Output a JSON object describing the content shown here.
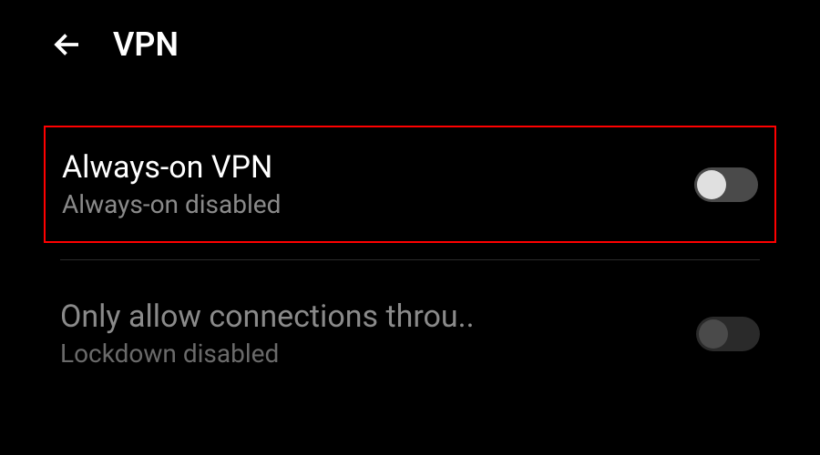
{
  "header": {
    "title": "VPN"
  },
  "settings": {
    "always_on": {
      "title": "Always-on VPN",
      "subtitle": "Always-on disabled"
    },
    "lockdown": {
      "title": "Only allow connections throu",
      "subtitle": "Lockdown disabled"
    }
  }
}
